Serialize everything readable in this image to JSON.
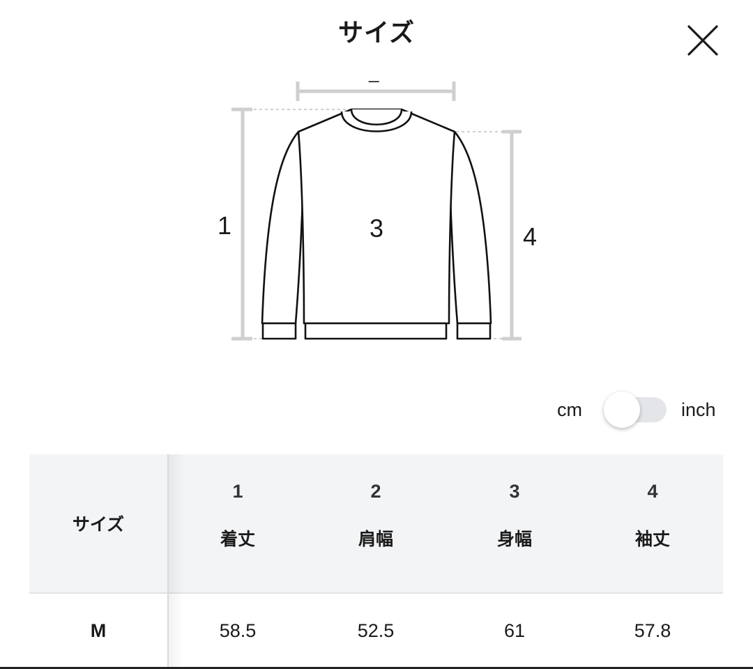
{
  "header": {
    "title": "サイズ",
    "close_icon": "close-icon"
  },
  "diagram": {
    "garment": "sweatshirt-outline",
    "labels": {
      "m1": "1",
      "m2": "_",
      "m3": "3",
      "m4": "4"
    },
    "colors": {
      "measure_line": "#cfcfcf",
      "outline": "#111111"
    }
  },
  "unit_toggle": {
    "left_label": "cm",
    "right_label": "inch",
    "selected": "cm"
  },
  "table": {
    "size_header": "サイズ",
    "columns": [
      {
        "num": "1",
        "name": "着丈"
      },
      {
        "num": "2",
        "name": "肩幅"
      },
      {
        "num": "3",
        "name": "身幅"
      },
      {
        "num": "4",
        "name": "袖丈"
      }
    ],
    "rows": [
      {
        "size": "M",
        "values": [
          "58.5",
          "52.5",
          "61",
          "57.8"
        ]
      }
    ],
    "colors": {
      "header_bg": "#f3f4f6",
      "divider": "#e1e2e5"
    }
  }
}
